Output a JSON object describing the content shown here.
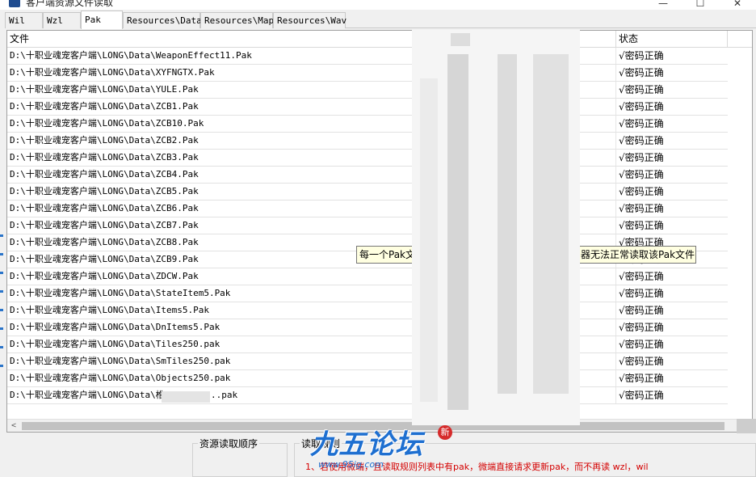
{
  "window": {
    "title": "客户端资源文件读取",
    "controls": {
      "minimize": "—",
      "maximize": "☐",
      "close": "✕"
    }
  },
  "tabs": [
    {
      "label": "Wil",
      "active": false
    },
    {
      "label": "Wzl",
      "active": false
    },
    {
      "label": "Pak",
      "active": true
    },
    {
      "label": "Resources\\Data",
      "active": false
    },
    {
      "label": "Resources\\Map",
      "active": false
    },
    {
      "label": "Resources\\Wav",
      "active": false
    }
  ],
  "list": {
    "columns": {
      "file": "文件",
      "status": "状态"
    },
    "rows": [
      {
        "path": "D:\\十职业魂宠客户端\\LONG\\Data\\WeaponEffect11.Pak",
        "status": "√密码正确"
      },
      {
        "path": "D:\\十职业魂宠客户端\\LONG\\Data\\XYFNGTX.Pak",
        "status": "√密码正确"
      },
      {
        "path": "D:\\十职业魂宠客户端\\LONG\\Data\\YULE.Pak",
        "status": "√密码正确"
      },
      {
        "path": "D:\\十职业魂宠客户端\\LONG\\Data\\ZCB1.Pak",
        "status": "√密码正确"
      },
      {
        "path": "D:\\十职业魂宠客户端\\LONG\\Data\\ZCB10.Pak",
        "status": "√密码正确"
      },
      {
        "path": "D:\\十职业魂宠客户端\\LONG\\Data\\ZCB2.Pak",
        "status": "√密码正确"
      },
      {
        "path": "D:\\十职业魂宠客户端\\LONG\\Data\\ZCB3.Pak",
        "status": "√密码正确"
      },
      {
        "path": "D:\\十职业魂宠客户端\\LONG\\Data\\ZCB4.Pak",
        "status": "√密码正确"
      },
      {
        "path": "D:\\十职业魂宠客户端\\LONG\\Data\\ZCB5.Pak",
        "status": "√密码正确"
      },
      {
        "path": "D:\\十职业魂宠客户端\\LONG\\Data\\ZCB6.Pak",
        "status": "√密码正确"
      },
      {
        "path": "D:\\十职业魂宠客户端\\LONG\\Data\\ZCB7.Pak",
        "status": "√密码正确"
      },
      {
        "path": "D:\\十职业魂宠客户端\\LONG\\Data\\ZCB8.Pak",
        "status": "√密码正确"
      },
      {
        "path": "D:\\十职业魂宠客户端\\LONG\\Data\\ZCB9.Pak",
        "status": "√密码正确"
      },
      {
        "path": "D:\\十职业魂宠客户端\\LONG\\Data\\ZDCW.Pak",
        "status": "√密码正确"
      },
      {
        "path": "D:\\十职业魂宠客户端\\LONG\\Data\\StateItem5.Pak",
        "status": "√密码正确"
      },
      {
        "path": "D:\\十职业魂宠客户端\\LONG\\Data\\Items5.Pak",
        "status": "√密码正确"
      },
      {
        "path": "D:\\十职业魂宠客户端\\LONG\\Data\\DnItems5.Pak",
        "status": "√密码正确"
      },
      {
        "path": "D:\\十职业魂宠客户端\\LONG\\Data\\Tiles250.pak",
        "status": "√密码正确"
      },
      {
        "path": "D:\\十职业魂宠客户端\\LONG\\Data\\SmTiles250.pak",
        "status": "√密码正确"
      },
      {
        "path": "D:\\十职业魂宠客户端\\LONG\\Data\\Objects250.pak",
        "status": "√密码正确"
      },
      {
        "path": "D:\\十职业魂宠客户端\\LONG\\Data\\椎",
        "path_suffix": "..pak",
        "status": "√密码正确"
      }
    ]
  },
  "tooltip": {
    "start": "每一个Pak文",
    "end": "器无法正常读取该Pak文件"
  },
  "scrollbar": {
    "left_arrow": "<",
    "right_arrow": ">"
  },
  "bottom": {
    "group1_label": "资源读取顺序",
    "group2_label": "读取规则",
    "notice": "1、若使用微端，且读取规则列表中有pak，微端直接请求更新pak，而不再读 wzl，wil"
  },
  "watermark": {
    "logo": "九五论坛",
    "url": "www.95ig.com",
    "badge": "新"
  }
}
